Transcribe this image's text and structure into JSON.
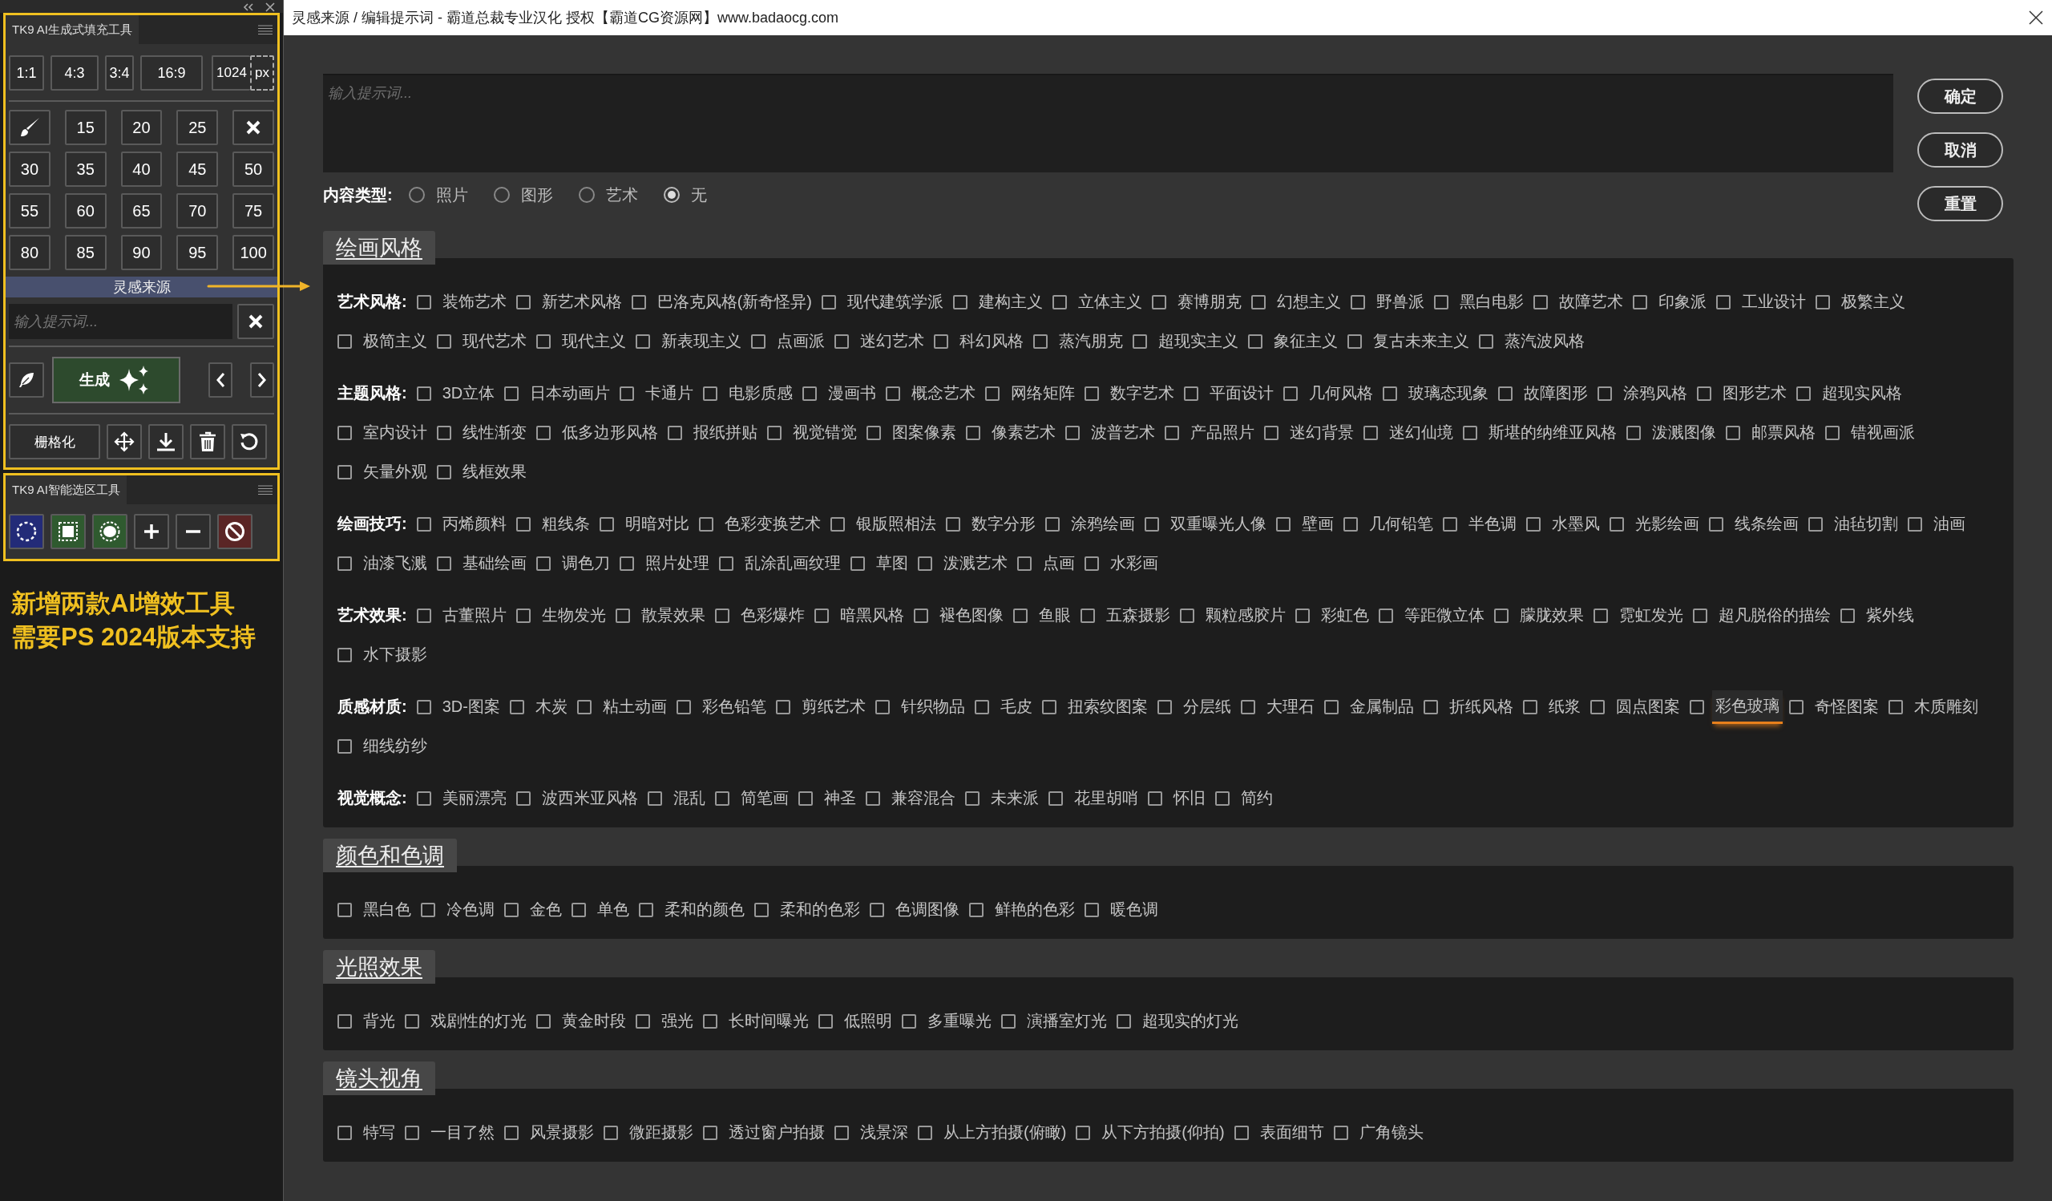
{
  "panel_fill": {
    "title": "TK9 AI生成式填充工具",
    "ratios": [
      "1:1",
      "4:3",
      "3:4",
      "16:9"
    ],
    "size": "1024",
    "unit": "px",
    "sizes": [
      "15",
      "20",
      "25",
      "30",
      "35",
      "40",
      "45",
      "50",
      "55",
      "60",
      "65",
      "70",
      "75",
      "80",
      "85",
      "90",
      "95",
      "100"
    ],
    "banner": "灵感来源",
    "prompt": {
      "placeholder": "输入提示词..."
    },
    "generate": "生成",
    "rasterize": "栅格化"
  },
  "panel_select": {
    "title": "TK9 AI智能选区工具"
  },
  "promo": [
    "新增两款AI增效工具",
    "需要PS 2024版本支持"
  ],
  "dialog": {
    "title": "灵感来源 / 编辑提示词 - 霸道总裁专业汉化 授权【霸道CG资源网】www.badaocg.com",
    "prompt": {
      "placeholder": "输入提示词..."
    },
    "buttons": [
      "确定",
      "取消",
      "重置"
    ],
    "content_type": {
      "label": "内容类型:",
      "options": [
        {
          "label": "照片",
          "selected": false
        },
        {
          "label": "图形",
          "selected": false
        },
        {
          "label": "艺术",
          "selected": false
        },
        {
          "label": "无",
          "selected": true
        }
      ]
    }
  },
  "sections": [
    {
      "title": "绘画风格",
      "groups": [
        {
          "label": "艺术风格:",
          "options": [
            {
              "label": "装饰艺术",
              "checked": false
            },
            {
              "label": "新艺术风格",
              "checked": false
            },
            {
              "label": "巴洛克风格(新奇怪异)",
              "checked": false
            },
            {
              "label": "现代建筑学派",
              "checked": false
            },
            {
              "label": "建构主义",
              "checked": false
            },
            {
              "label": "立体主义",
              "checked": false
            },
            {
              "label": "赛博朋克",
              "checked": false
            },
            {
              "label": "幻想主义",
              "checked": false
            },
            {
              "label": "野兽派",
              "checked": false
            },
            {
              "label": "黑白电影",
              "checked": false
            },
            {
              "label": "故障艺术",
              "checked": false
            },
            {
              "label": "印象派",
              "checked": false
            },
            {
              "label": "工业设计",
              "checked": false
            },
            {
              "label": "极繁主义",
              "checked": false
            },
            {
              "label": "极简主义",
              "checked": false
            },
            {
              "label": "现代艺术",
              "checked": false
            },
            {
              "label": "现代主义",
              "checked": false
            },
            {
              "label": "新表现主义",
              "checked": false
            },
            {
              "label": "点画派",
              "checked": false
            },
            {
              "label": "迷幻艺术",
              "checked": false
            },
            {
              "label": "科幻风格",
              "checked": false
            },
            {
              "label": "蒸汽朋克",
              "checked": false
            },
            {
              "label": "超现实主义",
              "checked": false
            },
            {
              "label": "象征主义",
              "checked": false
            },
            {
              "label": "复古未来主义",
              "checked": false
            },
            {
              "label": "蒸汽波风格",
              "checked": false
            }
          ]
        },
        {
          "label": "主题风格:",
          "options": [
            {
              "label": "3D立体",
              "checked": false
            },
            {
              "label": "日本动画片",
              "checked": false
            },
            {
              "label": "卡通片",
              "checked": false
            },
            {
              "label": "电影质感",
              "checked": false
            },
            {
              "label": "漫画书",
              "checked": false
            },
            {
              "label": "概念艺术",
              "checked": false
            },
            {
              "label": "网络矩阵",
              "checked": false
            },
            {
              "label": "数字艺术",
              "checked": false
            },
            {
              "label": "平面设计",
              "checked": false
            },
            {
              "label": "几何风格",
              "checked": false
            },
            {
              "label": "玻璃态现象",
              "checked": false
            },
            {
              "label": "故障图形",
              "checked": false
            },
            {
              "label": "涂鸦风格",
              "checked": false
            },
            {
              "label": "图形艺术",
              "checked": false
            },
            {
              "label": "超现实风格",
              "checked": false
            },
            {
              "label": "室内设计",
              "checked": false
            },
            {
              "label": "线性渐变",
              "checked": false
            },
            {
              "label": "低多边形风格",
              "checked": false
            },
            {
              "label": "报纸拼贴",
              "checked": false
            },
            {
              "label": "视觉错觉",
              "checked": false
            },
            {
              "label": "图案像素",
              "checked": false
            },
            {
              "label": "像素艺术",
              "checked": false
            },
            {
              "label": "波普艺术",
              "checked": false
            },
            {
              "label": "产品照片",
              "checked": false
            },
            {
              "label": "迷幻背景",
              "checked": false
            },
            {
              "label": "迷幻仙境",
              "checked": false
            },
            {
              "label": "斯堪的纳维亚风格",
              "checked": false
            },
            {
              "label": "泼溅图像",
              "checked": false
            },
            {
              "label": "邮票风格",
              "checked": false
            },
            {
              "label": "错视画派",
              "checked": false
            },
            {
              "label": "矢量外观",
              "checked": false
            },
            {
              "label": "线框效果",
              "checked": false
            }
          ]
        },
        {
          "label": "绘画技巧:",
          "options": [
            {
              "label": "丙烯颜料",
              "checked": false
            },
            {
              "label": "粗线条",
              "checked": false
            },
            {
              "label": "明暗对比",
              "checked": false
            },
            {
              "label": "色彩变换艺术",
              "checked": false
            },
            {
              "label": "银版照相法",
              "checked": false
            },
            {
              "label": "数字分形",
              "checked": false
            },
            {
              "label": "涂鸦绘画",
              "checked": false
            },
            {
              "label": "双重曝光人像",
              "checked": false
            },
            {
              "label": "壁画",
              "checked": false
            },
            {
              "label": "几何铅笔",
              "checked": false
            },
            {
              "label": "半色调",
              "checked": false
            },
            {
              "label": "水墨风",
              "checked": false
            },
            {
              "label": "光影绘画",
              "checked": false
            },
            {
              "label": "线条绘画",
              "checked": false
            },
            {
              "label": "油毡切割",
              "checked": false
            },
            {
              "label": "油画",
              "checked": false
            },
            {
              "label": "油漆飞溅",
              "checked": false
            },
            {
              "label": "基础绘画",
              "checked": false
            },
            {
              "label": "调色刀",
              "checked": false
            },
            {
              "label": "照片处理",
              "checked": false
            },
            {
              "label": "乱涂乱画纹理",
              "checked": false
            },
            {
              "label": "草图",
              "checked": false
            },
            {
              "label": "泼溅艺术",
              "checked": false
            },
            {
              "label": "点画",
              "checked": false
            },
            {
              "label": "水彩画",
              "checked": false
            }
          ]
        },
        {
          "label": "艺术效果:",
          "options": [
            {
              "label": "古董照片",
              "checked": false
            },
            {
              "label": "生物发光",
              "checked": false
            },
            {
              "label": "散景效果",
              "checked": false
            },
            {
              "label": "色彩爆炸",
              "checked": false
            },
            {
              "label": "暗黑风格",
              "checked": false
            },
            {
              "label": "褪色图像",
              "checked": false
            },
            {
              "label": "鱼眼",
              "checked": false
            },
            {
              "label": "五森摄影",
              "checked": false
            },
            {
              "label": "颗粒感胶片",
              "checked": false
            },
            {
              "label": "彩虹色",
              "checked": false
            },
            {
              "label": "等距微立体",
              "checked": false
            },
            {
              "label": "朦胧效果",
              "checked": false
            },
            {
              "label": "霓虹发光",
              "checked": false
            },
            {
              "label": "超凡脱俗的描绘",
              "checked": false
            },
            {
              "label": "紫外线",
              "checked": false
            },
            {
              "label": "水下摄影",
              "checked": false
            }
          ]
        },
        {
          "label": "质感材质:",
          "options": [
            {
              "label": "3D-图案",
              "checked": false
            },
            {
              "label": "木炭",
              "checked": false
            },
            {
              "label": "粘土动画",
              "checked": false
            },
            {
              "label": "彩色铅笔",
              "checked": false
            },
            {
              "label": "剪纸艺术",
              "checked": false
            },
            {
              "label": "针织物品",
              "checked": false
            },
            {
              "label": "毛皮",
              "checked": false
            },
            {
              "label": "扭索纹图案",
              "checked": false
            },
            {
              "label": "分层纸",
              "checked": false
            },
            {
              "label": "大理石",
              "checked": false
            },
            {
              "label": "金属制品",
              "checked": false
            },
            {
              "label": "折纸风格",
              "checked": false
            },
            {
              "label": "纸浆",
              "checked": false
            },
            {
              "label": "圆点图案",
              "checked": false
            },
            {
              "label": "彩色玻璃",
              "checked": false,
              "hovered": true
            },
            {
              "label": "奇怪图案",
              "checked": false
            },
            {
              "label": "木质雕刻",
              "checked": false
            },
            {
              "label": "细线纺纱",
              "checked": false
            }
          ]
        },
        {
          "label": "视觉概念:",
          "options": [
            {
              "label": "美丽漂亮",
              "checked": false
            },
            {
              "label": "波西米亚风格",
              "checked": false
            },
            {
              "label": "混乱",
              "checked": false
            },
            {
              "label": "简笔画",
              "checked": false
            },
            {
              "label": "神圣",
              "checked": false
            },
            {
              "label": "兼容混合",
              "checked": false
            },
            {
              "label": "未来派",
              "checked": false
            },
            {
              "label": "花里胡哨",
              "checked": false
            },
            {
              "label": "怀旧",
              "checked": false
            },
            {
              "label": "简约",
              "checked": false
            }
          ]
        }
      ]
    },
    {
      "title": "颜色和色调",
      "groups": [
        {
          "options": [
            {
              "label": "黑白色",
              "checked": false
            },
            {
              "label": "冷色调",
              "checked": false
            },
            {
              "label": "金色",
              "checked": false
            },
            {
              "label": "单色",
              "checked": false
            },
            {
              "label": "柔和的颜色",
              "checked": false
            },
            {
              "label": "柔和的色彩",
              "checked": false
            },
            {
              "label": "色调图像",
              "checked": false
            },
            {
              "label": "鲜艳的色彩",
              "checked": false
            },
            {
              "label": "暖色调",
              "checked": false
            }
          ]
        }
      ]
    },
    {
      "title": "光照效果",
      "groups": [
        {
          "options": [
            {
              "label": "背光",
              "checked": false
            },
            {
              "label": "戏剧性的灯光",
              "checked": false
            },
            {
              "label": "黄金时段",
              "checked": false
            },
            {
              "label": "强光",
              "checked": false
            },
            {
              "label": "长时间曝光",
              "checked": false
            },
            {
              "label": "低照明",
              "checked": false
            },
            {
              "label": "多重曝光",
              "checked": false
            },
            {
              "label": "演播室灯光",
              "checked": false
            },
            {
              "label": "超现实的灯光",
              "checked": false
            }
          ]
        }
      ]
    },
    {
      "title": "镜头视角",
      "groups": [
        {
          "options": [
            {
              "label": "特写",
              "checked": false
            },
            {
              "label": "一目了然",
              "checked": false
            },
            {
              "label": "风景摄影",
              "checked": false
            },
            {
              "label": "微距摄影",
              "checked": false
            },
            {
              "label": "透过窗户拍摄",
              "checked": false
            },
            {
              "label": "浅景深",
              "checked": false
            },
            {
              "label": "从上方拍摄(俯瞰)",
              "checked": false
            },
            {
              "label": "从下方拍摄(仰拍)",
              "checked": false
            },
            {
              "label": "表面细节",
              "checked": false
            },
            {
              "label": "广角镜头",
              "checked": false
            }
          ]
        }
      ]
    }
  ]
}
